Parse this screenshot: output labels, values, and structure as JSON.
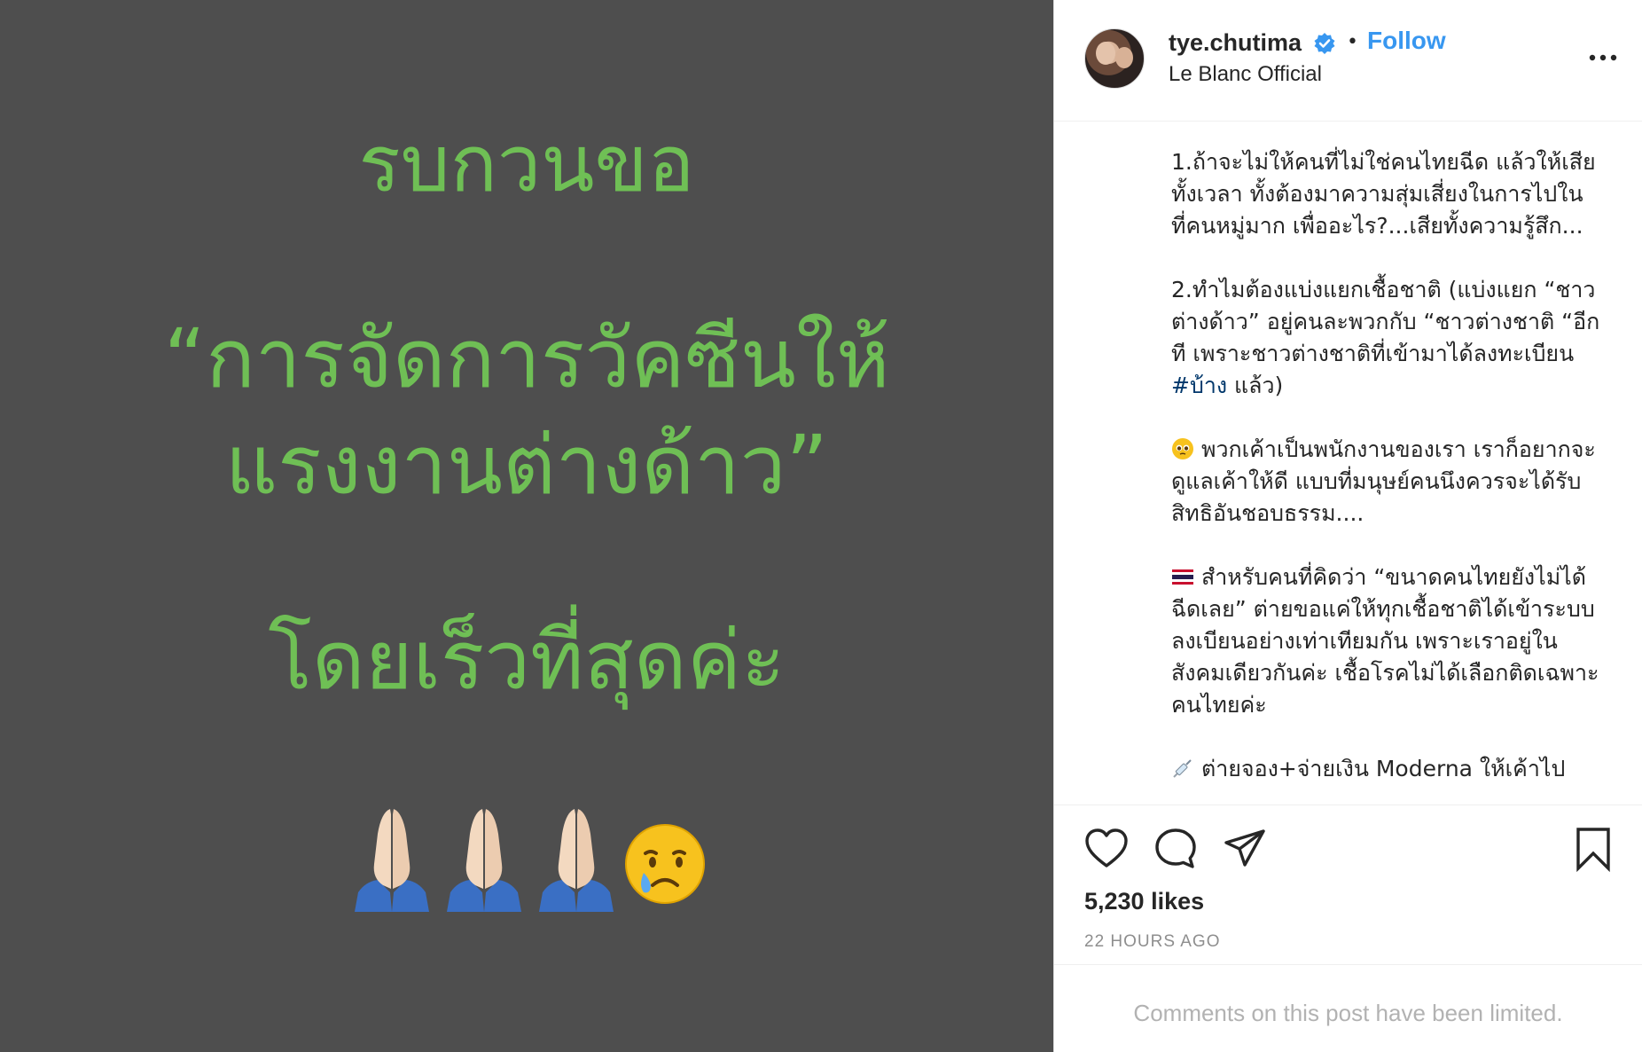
{
  "post_image": {
    "lines": [
      "รบกวนขอ",
      "“การจัดการวัคซีนให้",
      "แรงงานต่างด้าว”",
      "โดยเร็วที่สุดค่ะ"
    ],
    "text_color": "#6fbf55",
    "background_color": "#4e4e4e",
    "emoji_icons": [
      "folded-hands-icon",
      "folded-hands-icon",
      "folded-hands-icon",
      "crying-face-icon"
    ]
  },
  "header": {
    "username": "tye.chutima",
    "verified_icon": "verified-badge-icon",
    "separator": "•",
    "follow_label": "Follow",
    "subtitle": "Le Blanc Official",
    "more_icon": "more-options-icon"
  },
  "caption": {
    "p1": [
      "1.ถ้าจะไม่ให้คนที่ไม่ใช่คนไทยฉีด แล้วให้เสีย",
      "ทั้งเวลา ทั้งต้องมาความสุ่มเสี่ยงในการไปใน",
      "ที่คนหมู่มาก เพื่ออะไร?...เสียทั้งความรู้สึก..."
    ],
    "p2": [
      "2.ทำไมต้องแบ่งแยกเชื้อชาติ (แบ่งแยก “ชาว",
      "ต่างด้าว” อยู่คนละพวกกับ “ชาวต่างชาติ “อีก",
      "ที เพราะชาวต่างชาติที่เข้ามาได้ลงทะเบียน"
    ],
    "p2_hashtag": "#บ้าง",
    "p2_tail": " แล้ว)",
    "p3_first": "พวกเค้าเป็นพนักงานของเรา เราก็อยากจะ",
    "p3_rest": [
      "ดูแลเค้าให้ดี แบบที่มนุษย์คนนึงควรจะได้รับ",
      "สิทธิอันชอบธรรม...."
    ],
    "p4_first": "สำหรับคนที่คิดว่า “ขนาดคนไทยยังไม่ได้",
    "p4_rest": [
      "ฉีดเลย” ต่ายขอแค่ให้ทุกเชื้อชาติได้เข้าระบบ",
      "ลงเบียนอย่างเท่าเทียมกัน เพราะเราอยู่ใน",
      "สังคมเดียวกันค่ะ เชื้อโรคไม่ได้เลือกติดเฉพาะ",
      "คนไทยค่ะ"
    ],
    "p5_first": "ต่ายจอง+จ่ายเงิน Moderna ให้เค้าไป",
    "emoji_icons": {
      "p3": "pleading-face-icon",
      "p4": "thailand-flag-icon",
      "p5": "syringe-icon"
    }
  },
  "actions": {
    "like_icon": "heart-icon",
    "comment_icon": "comment-icon",
    "share_icon": "paper-plane-icon",
    "save_icon": "bookmark-icon",
    "likes": "5,230 likes",
    "timestamp": "22 HOURS AGO"
  },
  "comments": {
    "limited_text": "Comments on this post have been limited."
  },
  "colors": {
    "link_blue": "#3897f0",
    "hashtag": "#00376b",
    "text": "#262626",
    "muted": "#8e8e8e"
  }
}
